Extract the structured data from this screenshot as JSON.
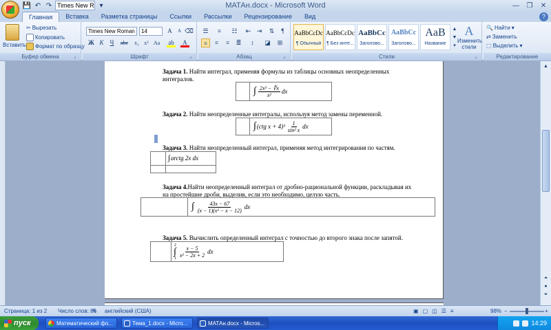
{
  "window": {
    "title": "МАТАн.docx - Microsoft Word",
    "qat_font": "Times New Ro"
  },
  "tabs": [
    "Главная",
    "Вставка",
    "Разметка страницы",
    "Ссылки",
    "Рассылки",
    "Рецензирование",
    "Вид"
  ],
  "ribbon": {
    "clipboard": {
      "paste": "Вставить",
      "cut": "Вырезать",
      "copy": "Копировать",
      "format_painter": "Формат по образцу",
      "label": "Буфер обмена"
    },
    "font": {
      "name": "Times New Roman",
      "size": "14",
      "label": "Шрифт"
    },
    "paragraph": {
      "label": "Абзац"
    },
    "styles": {
      "label": "Стили",
      "items": [
        {
          "sample": "AaBbCcDc",
          "name": "¶ Обычный"
        },
        {
          "sample": "AaBbCcDc",
          "name": "¶ Без инте..."
        },
        {
          "sample": "AaBbCc",
          "name": "Заголово..."
        },
        {
          "sample": "AaBbCc",
          "name": "Заголово..."
        },
        {
          "sample": "AaB",
          "name": "Название"
        }
      ],
      "change": "Изменить стили"
    },
    "editing": {
      "find": "Найти",
      "replace": "Заменить",
      "select": "Выделить",
      "label": "Редактирование"
    }
  },
  "document": {
    "task1": {
      "label": "Задача 1.",
      "text": " Найти интеграл, применяя формулы из таблицы основных неопределенных интегралов."
    },
    "task2": {
      "label": "Задача 2.",
      "text": " Найти неопределенные интегралы, используя метод замены переменной."
    },
    "task3": {
      "label": "Задача 3.",
      "text": " Найти неопределенный интеграл, применяя метод интегрирования по частям."
    },
    "task4": {
      "label": "Задача 4.",
      "text": "Найти неопределенный интеграл от дробно-рациональной функции, раскладывая их на простейшие дроби, выделив, если это необходимо, целую часть."
    },
    "task5": {
      "label": "Задача 5.",
      "text": " Вычислить определенный интеграл с точностью до второго знака после запятой."
    },
    "formula1": {
      "num": "2x³ − ∜x",
      "den": "x²",
      "tail": "dx"
    },
    "formula2": {
      "head": "(ctg x + 4)³",
      "num": "1",
      "den": "sin² x",
      "tail": "dx"
    },
    "formula3": {
      "text": "arctg 2x dx"
    },
    "formula4": {
      "num": "43x − 67",
      "den": "(x − 1)(x² − x − 12)",
      "tail": "dx"
    },
    "formula5": {
      "upper": "2",
      "lower": "1",
      "num": "x − 5",
      "den": "x² − 2x + 2",
      "tail": "dx"
    }
  },
  "status": {
    "page": "Страница: 1 из 2",
    "words": "Число слов: 86",
    "lang": "английский (США)",
    "zoom": "98%"
  },
  "taskbar": {
    "start": "пуск",
    "items": [
      "Математический фо...",
      "Тема_1.docx - Micro...",
      "МАТАн.docx - Micros..."
    ],
    "clock": "14:29"
  }
}
